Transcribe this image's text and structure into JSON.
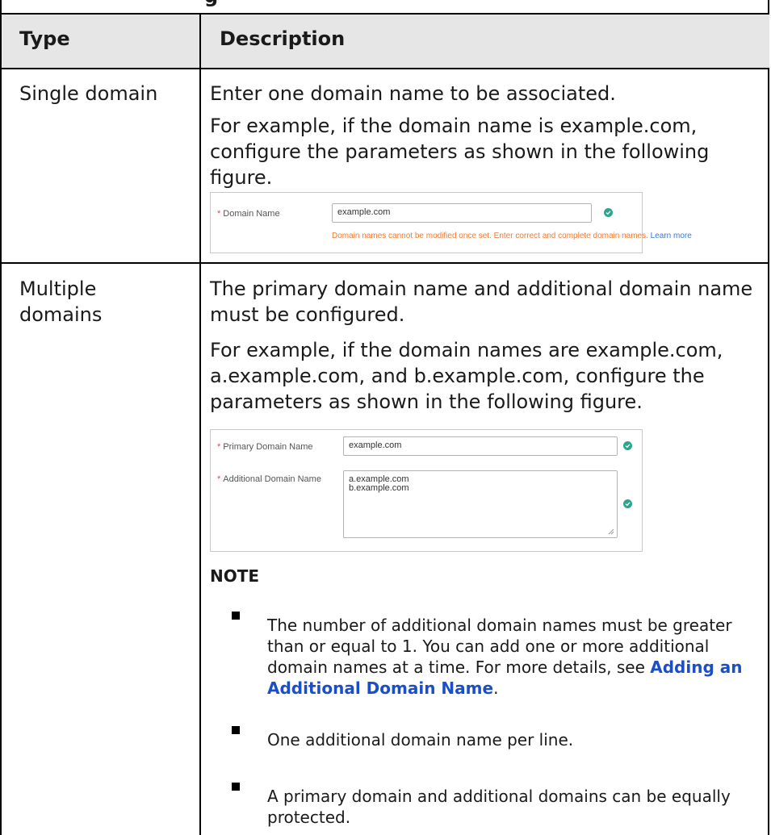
{
  "cut_title": "g",
  "table": {
    "headers": {
      "type": "Type",
      "description": "Description"
    },
    "rows": [
      {
        "type": "Single domain",
        "paragraphs": [
          "Enter one domain name to be associated.",
          "For example, if the domain name is example.com, configure the parameters as shown in the following figure."
        ],
        "figure": {
          "required_mark": "*",
          "label": "Domain Name",
          "value": "example.com",
          "hint": "Domain names cannot be modified once set. Enter correct and complete domain names.",
          "hint_link": "Learn more",
          "colors": {
            "hint": "#f07a32",
            "link": "#3778d8",
            "check": "#2ea58a"
          }
        }
      },
      {
        "type_line1": "Multiple",
        "type_line2": "domains",
        "paragraphs": [
          "The primary domain name and additional domain name must be configured.",
          "For example, if the domain names are example.com, a.example.com, and b.example.com, configure the parameters as shown in the following figure."
        ],
        "figure": {
          "required_mark": "*",
          "primary_label": "Primary Domain Name",
          "primary_value": "example.com",
          "additional_label": "Additional Domain Name",
          "additional_line1": "a.example.com",
          "additional_line2": "b.example.com"
        },
        "note": {
          "title": "NOTE",
          "items": [
            {
              "text": "The number of additional domain names must be greater than or equal to 1. You can add one or more additional domain names at a time. For more details, see ",
              "link": "Adding an Additional Domain Name",
              "after": "."
            },
            {
              "text": "One additional domain name per line."
            },
            {
              "text": "A primary domain and additional domains can be equally protected."
            }
          ]
        }
      }
    ]
  }
}
